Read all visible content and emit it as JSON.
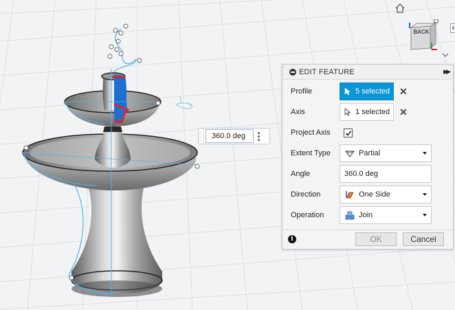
{
  "canvas": {
    "angle_value": "360.0 deg"
  },
  "viewcube": {
    "face_label": "BACK",
    "side_tab": "H"
  },
  "panel": {
    "title": "EDIT FEATURE",
    "rows": {
      "profile": {
        "label": "Profile",
        "value": "5 selected"
      },
      "axis": {
        "label": "Axis",
        "value": "1 selected"
      },
      "project_axis": {
        "label": "Project Axis",
        "checked": true
      },
      "extent_type": {
        "label": "Extent Type",
        "value": "Partial",
        "icon": "partial-icon"
      },
      "angle": {
        "label": "Angle",
        "value": "360.0 deg"
      },
      "direction": {
        "label": "Direction",
        "value": "One Side",
        "icon": "one-side-icon"
      },
      "operation": {
        "label": "Operation",
        "value": "Join",
        "icon": "join-icon"
      }
    },
    "ok_label": "OK",
    "cancel_label": "Cancel"
  },
  "colors": {
    "accent_blue": "#0a96d6",
    "profile_highlight": "#1e6fd0",
    "selection_red": "#e0242c",
    "model_gray": "#8e8e8e"
  }
}
